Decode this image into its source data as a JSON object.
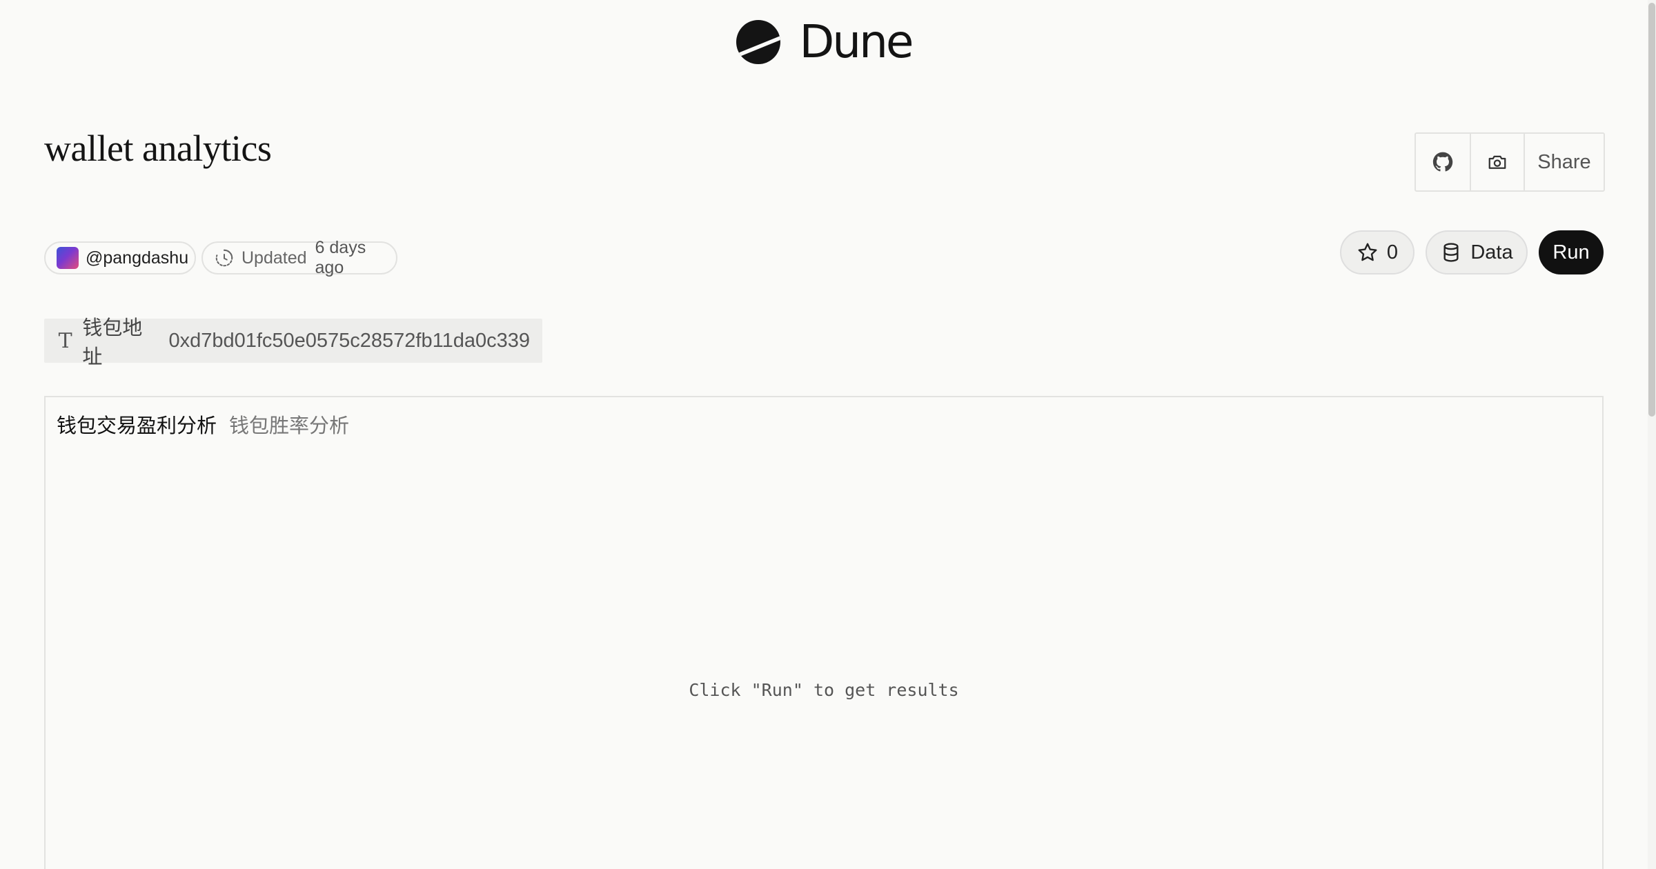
{
  "brand": {
    "name": "Dune"
  },
  "dashboard": {
    "title": "wallet analytics",
    "author": "@pangdashu",
    "updated_label": "Updated",
    "updated_value": "6 days ago"
  },
  "actions": {
    "share_label": "Share",
    "star_count": "0",
    "data_label": "Data",
    "run_label": "Run"
  },
  "parameter": {
    "label": "钱包地址",
    "value": "0xd7bd01fc50e0575c28572fb11da0c339"
  },
  "results": {
    "tabs": [
      {
        "label": "钱包交易盈利分析",
        "active": true
      },
      {
        "label": "钱包胜率分析",
        "active": false
      }
    ],
    "empty_message": "Click \"Run\" to get results"
  },
  "colors": {
    "background": "#fafaf8",
    "run_button": "#111111",
    "border": "#e2e2e0"
  }
}
